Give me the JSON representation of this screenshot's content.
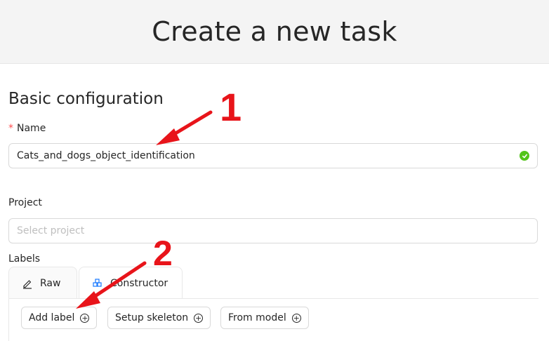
{
  "header": {
    "title": "Create a new task"
  },
  "section": {
    "title": "Basic configuration"
  },
  "name_field": {
    "required_mark": "*",
    "label": "Name",
    "value": "Cats_and_dogs_object_identification"
  },
  "project_field": {
    "label": "Project",
    "placeholder": "Select project"
  },
  "labels": {
    "label": "Labels",
    "tabs": [
      {
        "label": "Raw",
        "icon": "edit-icon"
      },
      {
        "label": "Constructor",
        "icon": "blocks-icon"
      }
    ],
    "buttons": [
      {
        "label": "Add label"
      },
      {
        "label": "Setup skeleton"
      },
      {
        "label": "From model"
      }
    ]
  },
  "annotations": {
    "one": "1",
    "two": "2"
  },
  "colors": {
    "annotation": "#e8141a",
    "valid": "#52c41a",
    "accent": "#1677ff"
  }
}
